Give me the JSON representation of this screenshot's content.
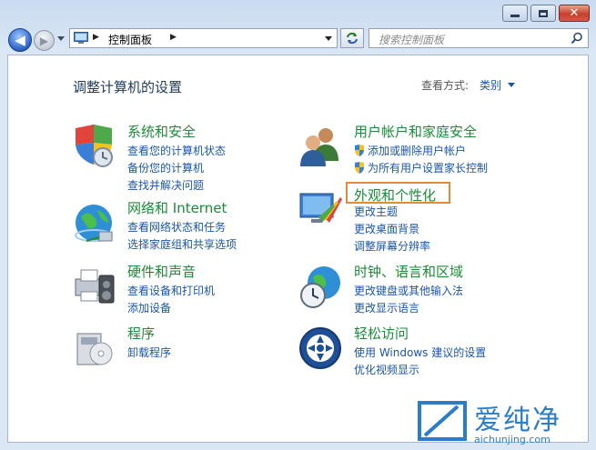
{
  "address": {
    "crumb": "控制面板"
  },
  "search": {
    "placeholder": "搜索控制面板"
  },
  "heading": "调整计算机的设置",
  "view": {
    "label": "查看方式:",
    "value": "类别"
  },
  "categories": [
    {
      "title": "系统和安全",
      "links": [
        "查看您的计算机状态",
        "备份您的计算机",
        "查找并解决问题"
      ]
    },
    {
      "title": "网络和 Internet",
      "links": [
        "查看网络状态和任务",
        "选择家庭组和共享选项"
      ]
    },
    {
      "title": "硬件和声音",
      "links": [
        "查看设备和打印机",
        "添加设备"
      ]
    },
    {
      "title": "程序",
      "links": [
        "卸载程序"
      ]
    },
    {
      "title": "用户帐户和家庭安全",
      "links": [
        "添加或删除用户帐户",
        "为所有用户设置家长控制"
      ]
    },
    {
      "title": "外观和个性化",
      "links": [
        "更改主题",
        "更改桌面背景",
        "调整屏幕分辨率"
      ]
    },
    {
      "title": "时钟、语言和区域",
      "links": [
        "更改键盘或其他输入法",
        "更改显示语言"
      ]
    },
    {
      "title": "轻松访问",
      "links": [
        "使用 Windows 建议的设置",
        "优化视频显示"
      ]
    }
  ],
  "watermark": {
    "text": "爱纯净",
    "url": "aichunjing.com"
  },
  "colors": {
    "category_title": "#1d8a3a",
    "link": "#1a56a8",
    "highlight": "#e38a3a",
    "heading": "#1e3a5f"
  }
}
